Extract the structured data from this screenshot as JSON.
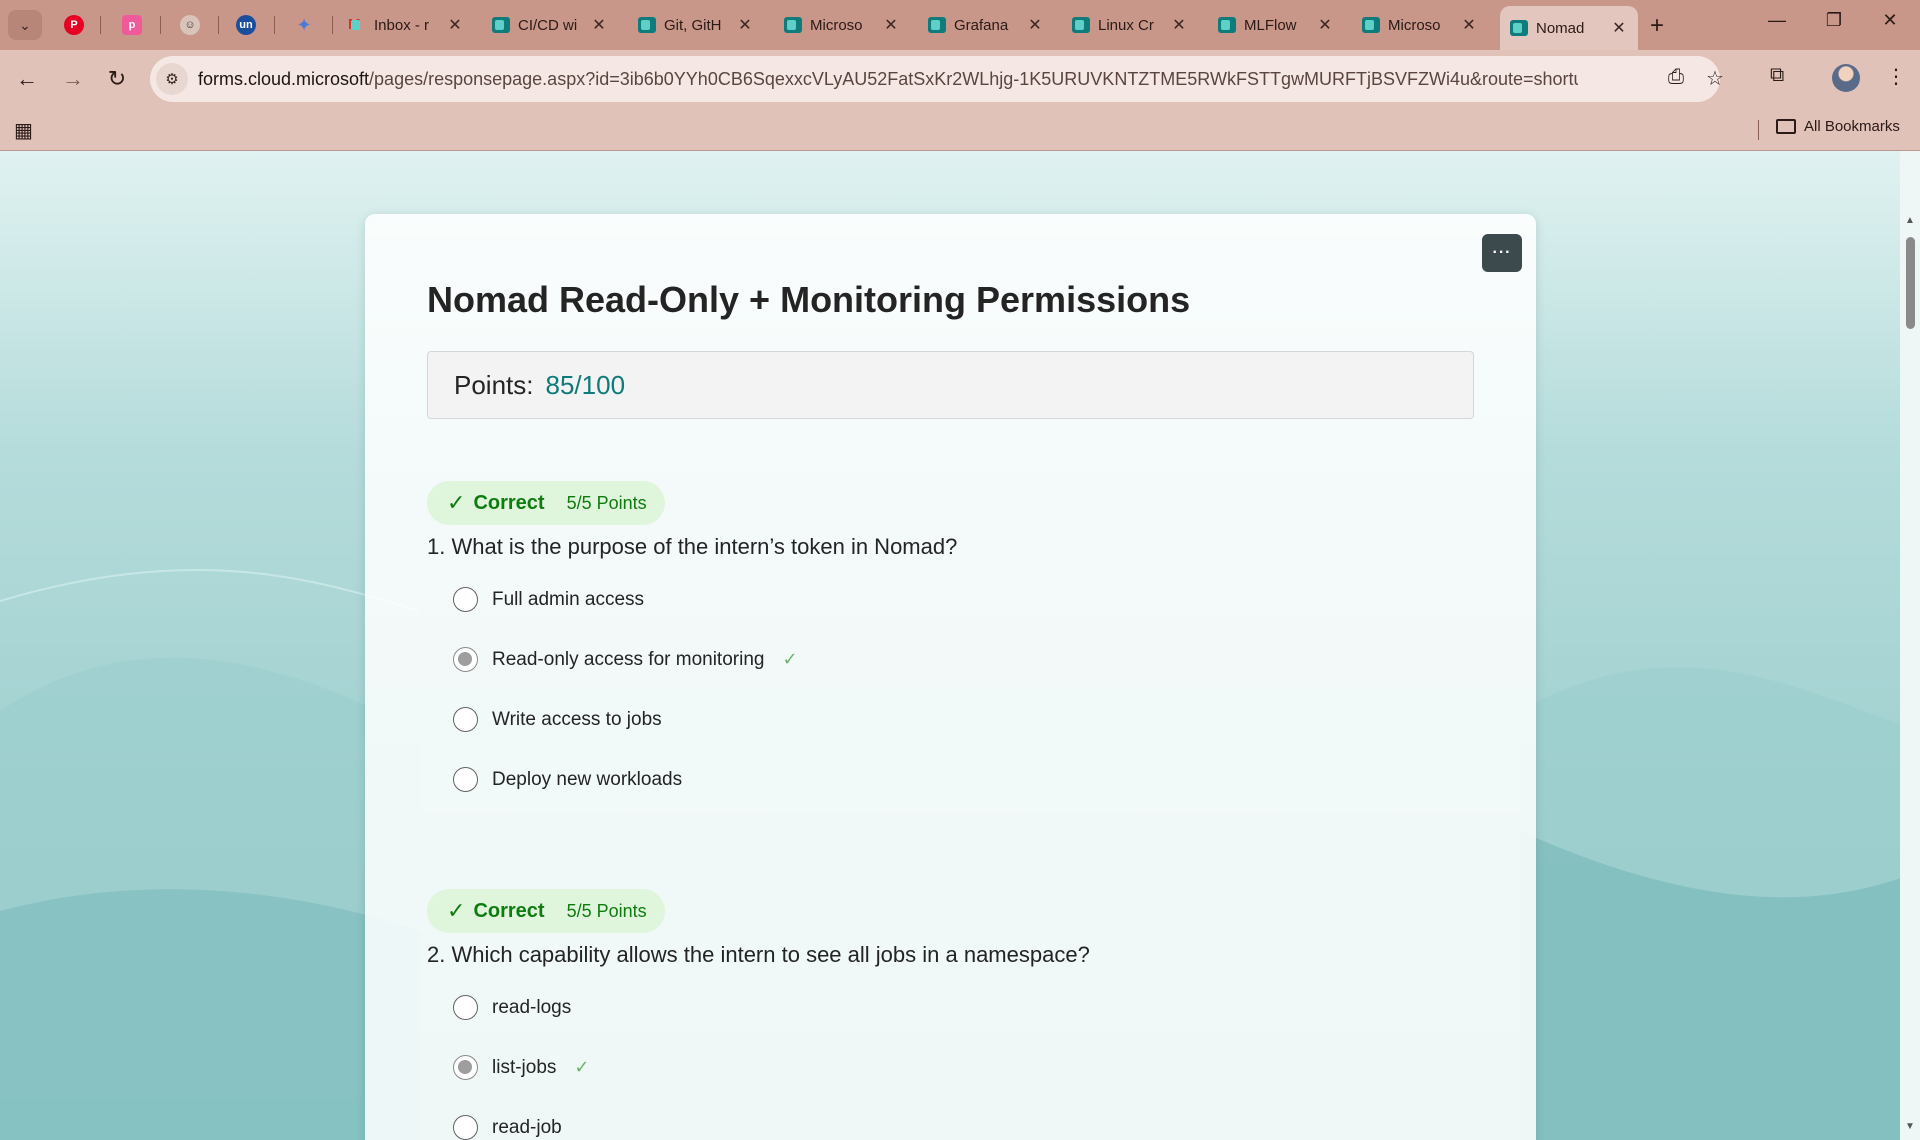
{
  "browser": {
    "tabs": [
      {
        "title": "Inbox - r",
        "icon": "gmail-icon"
      },
      {
        "title": "CI/CD wi",
        "icon": "forms-icon"
      },
      {
        "title": "Git, GitH",
        "icon": "forms-icon"
      },
      {
        "title": "Microso",
        "icon": "forms-icon"
      },
      {
        "title": "Grafana",
        "icon": "forms-icon"
      },
      {
        "title": "Linux Cr",
        "icon": "forms-icon"
      },
      {
        "title": "MLFlow",
        "icon": "forms-icon"
      },
      {
        "title": "Microso",
        "icon": "forms-icon"
      },
      {
        "title": "Nomad",
        "icon": "forms-icon",
        "active": true
      }
    ],
    "pinned": [
      "pinterest-icon",
      "picsart-icon",
      "avatar-icon",
      "unstop-icon",
      "gemini-icon"
    ],
    "url_host": "forms.cloud.microsoft",
    "url_path": "/pages/responsepage.aspx?id=3ib6b0YYh0CB6SqexxcVLyAU52FatSxKr2WLhjg-1K5URUVKNTZTME5RWkFSTTgwMURFTjBSVFZWi4u&route=shorturl",
    "bookmarks_label": "All Bookmarks"
  },
  "form": {
    "title": "Nomad Read-Only + Monitoring Permissions",
    "points_label": "Points:",
    "points_value": "85/100",
    "more_label": "···"
  },
  "questions": [
    {
      "status": "Correct",
      "points": "5/5 Points",
      "text": "1. What is the purpose of the intern’s token in Nomad?",
      "options": [
        {
          "label": "Full admin access",
          "selected": false,
          "correct": false
        },
        {
          "label": "Read-only access for monitoring",
          "selected": true,
          "correct": true
        },
        {
          "label": "Write access to jobs",
          "selected": false,
          "correct": false
        },
        {
          "label": "Deploy new workloads",
          "selected": false,
          "correct": false
        }
      ]
    },
    {
      "status": "Correct",
      "points": "5/5 Points",
      "text": "2. Which capability allows the intern to see all jobs in a namespace?",
      "options": [
        {
          "label": "read-logs",
          "selected": false,
          "correct": false
        },
        {
          "label": "list-jobs",
          "selected": true,
          "correct": true
        },
        {
          "label": "read-job",
          "selected": false,
          "correct": false
        }
      ]
    }
  ],
  "colors": {
    "accent_teal": "#0f7a7a",
    "correct_green": "#107c10",
    "correct_bg": "#dff6dd",
    "chrome": "#c8978a"
  }
}
